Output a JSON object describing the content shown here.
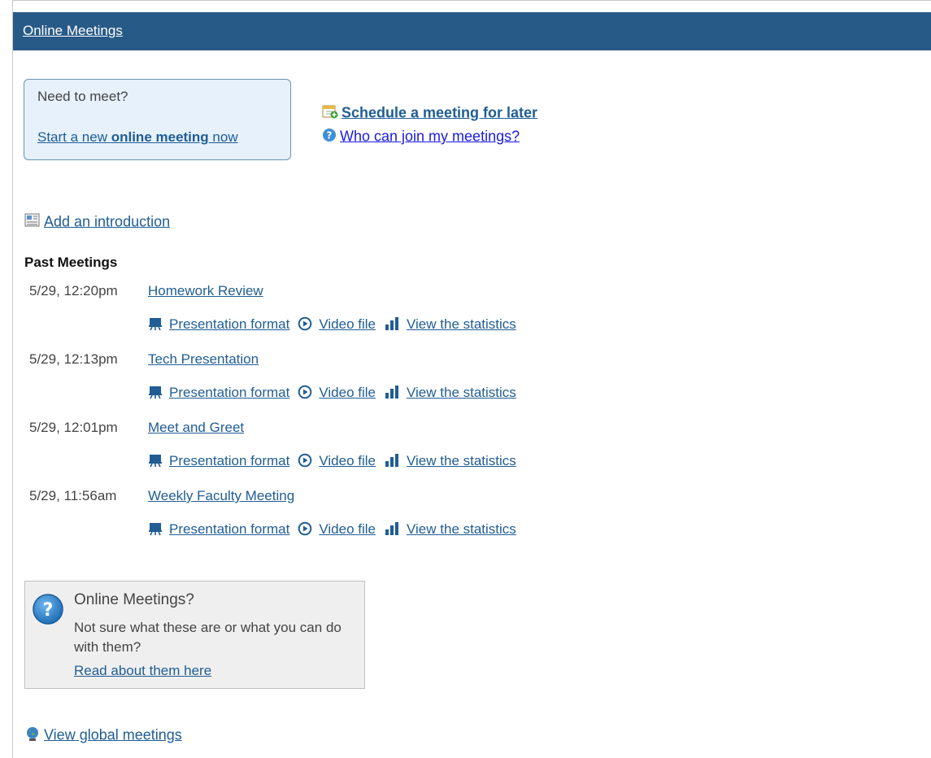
{
  "header": {
    "title": "Online Meetings"
  },
  "meet_box": {
    "question": "Need to meet?",
    "start_prefix": "Start a new ",
    "start_bold": "online meeting",
    "start_suffix": " now"
  },
  "links": {
    "schedule": "Schedule a meeting for later",
    "who_can_join": "Who can join my meetings?",
    "add_intro": "Add an introduction",
    "global": "View global meetings"
  },
  "past_meetings": {
    "title": "Past Meetings",
    "link_labels": {
      "presentation": "Presentation format",
      "video": "Video file",
      "stats": "View the statistics"
    },
    "items": [
      {
        "date": "5/29, 12:20pm",
        "name": "Homework Review"
      },
      {
        "date": "5/29, 12:13pm",
        "name": "Tech Presentation"
      },
      {
        "date": "5/29, 12:01pm",
        "name": "Meet and Greet"
      },
      {
        "date": "5/29, 11:56am",
        "name": "Weekly Faculty Meeting"
      }
    ]
  },
  "help": {
    "title": "Online Meetings?",
    "body": "Not sure what these are or what you can do with them?",
    "link": "Read about them here"
  },
  "colors": {
    "header": "#275a87",
    "link": "#1f5d94",
    "accent_link": "#1a1ae6"
  }
}
